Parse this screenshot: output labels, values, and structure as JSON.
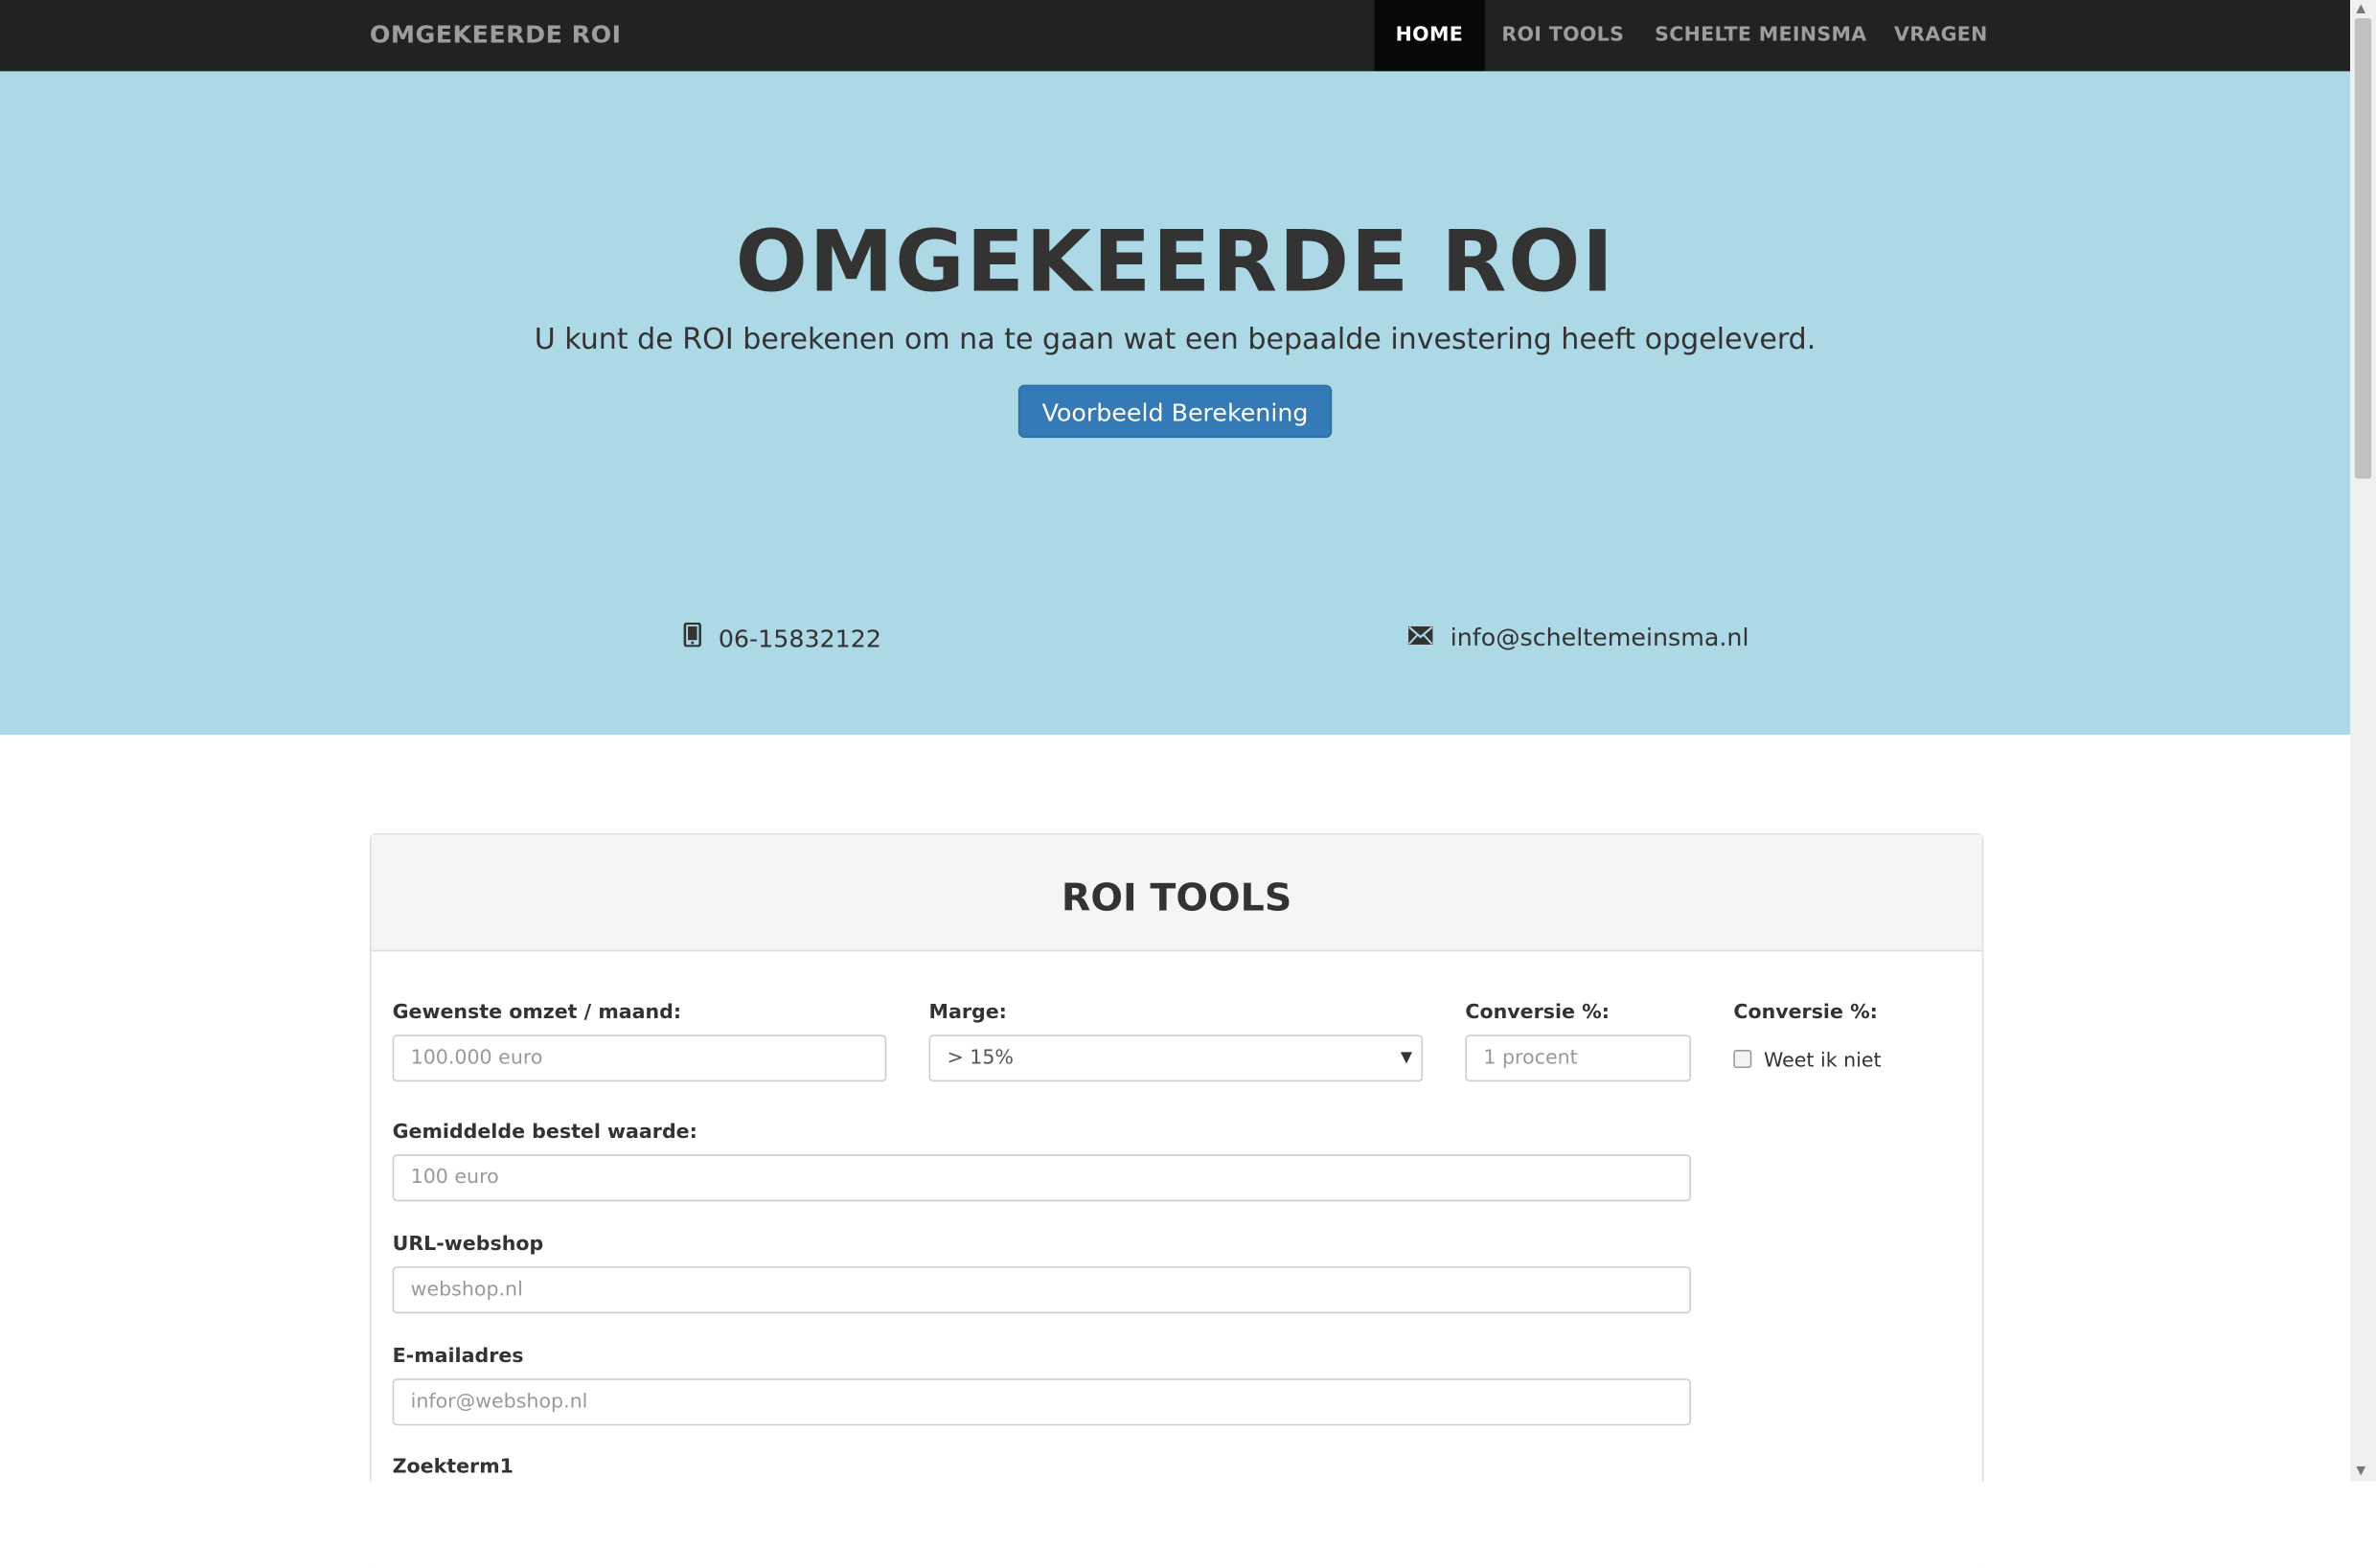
{
  "navbar": {
    "brand": "OMGEKEERDE ROI",
    "items": [
      {
        "label": "HOME",
        "active": true
      },
      {
        "label": "ROI TOOLS",
        "active": false
      },
      {
        "label": "SCHELTE MEINSMA",
        "active": false
      },
      {
        "label": "VRAGEN",
        "active": false
      }
    ]
  },
  "hero": {
    "title": "OMGEKEERDE ROI",
    "subtitle": "U kunt de ROI berekenen om na te gaan wat een bepaalde investering heeft opgeleverd.",
    "button_label": "Voorbeeld Berekening",
    "phone": "06-15832122",
    "email": "info@scheltemeinsma.nl"
  },
  "panel": {
    "title": "ROI TOOLS",
    "fields": {
      "omzet_label": "Gewenste omzet / maand:",
      "omzet_placeholder": "100.000 euro",
      "marge_label": "Marge:",
      "marge_value": "> 15%",
      "conversie_label": "Conversie %:",
      "conversie_placeholder": "1 procent",
      "conversie2_label": "Conversie %:",
      "checkbox_label": "Weet ik niet",
      "bestel_label": "Gemiddelde bestel waarde:",
      "bestel_placeholder": "100 euro",
      "url_label": "URL-webshop",
      "url_placeholder": "webshop.nl",
      "email_label": "E-mailadres",
      "email_placeholder": "infor@webshop.nl",
      "zoekterm_label": "Zoekterm1"
    }
  },
  "colors": {
    "navbar_bg": "#222222",
    "hero_bg": "#add8e6",
    "primary": "#337ab7"
  },
  "icons": {
    "phone": "mobile-phone-icon",
    "email": "envelope-icon"
  }
}
